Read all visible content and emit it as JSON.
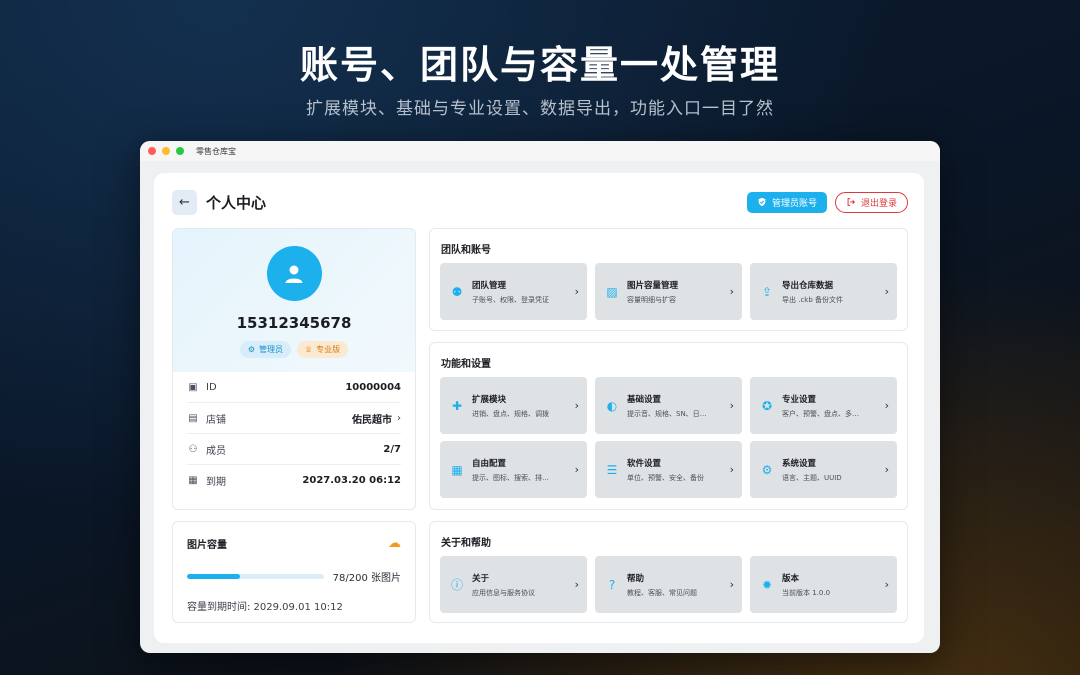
{
  "hero": {
    "title": "账号、团队与容量一处管理",
    "subtitle": "扩展模块、基础与专业设置、数据导出，功能入口一目了然"
  },
  "window": {
    "app_name": "零售仓库宝"
  },
  "header": {
    "back_icon": "arrow-left-icon",
    "title": "个人中心",
    "admin_button": "管理员账号",
    "logout_button": "退出登录"
  },
  "profile": {
    "phone": "15312345678",
    "badges": [
      "管理员",
      "专业版"
    ],
    "rows": [
      {
        "label": "ID",
        "value": "10000004",
        "icon": "id-card-icon"
      },
      {
        "label": "店铺",
        "value": "佑民超市",
        "icon": "store-icon"
      },
      {
        "label": "成员",
        "value": "2/7",
        "icon": "members-icon"
      },
      {
        "label": "到期",
        "value": "2027.03.20 06:12",
        "icon": "calendar-icon"
      }
    ]
  },
  "storage": {
    "title": "图片容量",
    "used": 78,
    "total": 200,
    "progress_text": "78/200 张图片",
    "expire_text": "容量到期时间: 2029.09.01 10:12"
  },
  "sections": [
    {
      "title": "团队和账号",
      "items": [
        {
          "title": "团队管理",
          "subtitle": "子账号、权限、登录凭证",
          "icon": "team-icon"
        },
        {
          "title": "图片容量管理",
          "subtitle": "容量明细与扩容",
          "icon": "image-icon"
        },
        {
          "title": "导出仓库数据",
          "subtitle": "导出 .ckb 备份文件",
          "icon": "export-icon"
        }
      ]
    },
    {
      "title": "功能和设置",
      "items": [
        {
          "title": "扩展模块",
          "subtitle": "进销、盘点、规格、调拨",
          "icon": "puzzle-icon"
        },
        {
          "title": "基础设置",
          "subtitle": "提示音、规格、SN、日…",
          "icon": "toggle-icon"
        },
        {
          "title": "专业设置",
          "subtitle": "客户、预警、盘点、多…",
          "icon": "award-icon"
        },
        {
          "title": "自由配置",
          "subtitle": "提示、图标、搜索、排…",
          "icon": "grid-plus-icon"
        },
        {
          "title": "软件设置",
          "subtitle": "单位、预警、安全、备份",
          "icon": "sliders-icon"
        },
        {
          "title": "系统设置",
          "subtitle": "语言、主题、UUID",
          "icon": "gear-icon"
        }
      ]
    },
    {
      "title": "关于和帮助",
      "items": [
        {
          "title": "关于",
          "subtitle": "应用信息与服务协议",
          "icon": "info-icon"
        },
        {
          "title": "帮助",
          "subtitle": "教程、客服、常见问题",
          "icon": "help-icon"
        },
        {
          "title": "版本",
          "subtitle": "当前版本 1.0.0",
          "icon": "badge-icon"
        }
      ]
    }
  ],
  "colors": {
    "accent": "#1cb0ec",
    "danger": "#e0383b",
    "orange": "#f39a1e"
  }
}
